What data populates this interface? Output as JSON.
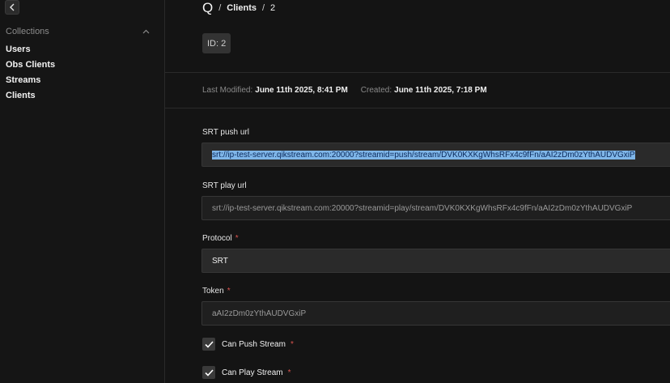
{
  "sidebar": {
    "section_title": "Collections",
    "items": [
      {
        "label": "Users"
      },
      {
        "label": "Obs Clients"
      },
      {
        "label": "Streams"
      },
      {
        "label": "Clients"
      }
    ]
  },
  "header": {
    "logo": "Q",
    "sep1": "/",
    "collection": "Clients",
    "sep2": "/",
    "record_id": "2"
  },
  "id_badge": "ID: 2",
  "meta": {
    "modified_label": "Last Modified:",
    "modified_value": "June 11th 2025, 8:41 PM",
    "created_label": "Created:",
    "created_value": "June 11th 2025, 7:18 PM"
  },
  "fields": {
    "srt_push": {
      "label": "SRT push url",
      "value": "srt://ip-test-server.qikstream.com:20000?streamid=push/stream/DVK0KXKgWhsRFx4c9fFn/aAI2zDm0zYthAUDVGxiP"
    },
    "srt_play": {
      "label": "SRT play url",
      "value": "srt://ip-test-server.qikstream.com:20000?streamid=play/stream/DVK0KXKgWhsRFx4c9fFn/aAI2zDm0zYthAUDVGxiP"
    },
    "protocol": {
      "label": "Protocol",
      "required": "*",
      "value": "SRT"
    },
    "token": {
      "label": "Token",
      "required": "*",
      "value": "aAI2zDm0zYthAUDVGxiP"
    }
  },
  "checkboxes": {
    "can_push": {
      "label": "Can Push Stream",
      "required": "*",
      "checked": true
    },
    "can_play": {
      "label": "Can Play Stream",
      "required": "*",
      "checked": true
    }
  },
  "colors": {
    "background": "#141414",
    "required": "#d9534f",
    "selection": "#7fb6e8"
  }
}
